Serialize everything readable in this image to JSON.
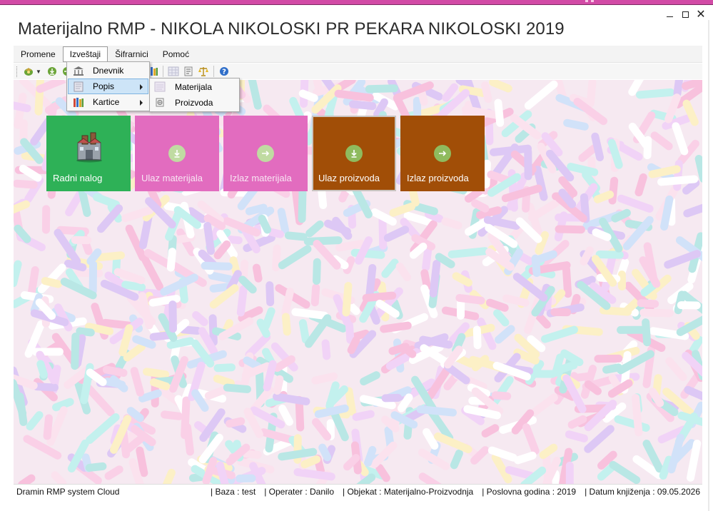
{
  "window": {
    "title": "Materijalno RMP - NIKOLA NIKOLOSKI PR PEKARA NIKOLOSKI 2019",
    "controls": {
      "minimize": "minimize-icon",
      "maximize": "maximize-icon",
      "close": "close-icon"
    }
  },
  "menu": {
    "items": [
      {
        "label": "Promene"
      },
      {
        "label": "Izveštaji",
        "active": true
      },
      {
        "label": "Šifrarnici"
      },
      {
        "label": "Pomoć"
      }
    ]
  },
  "reports_menu": {
    "items": [
      {
        "label": "Dnevnik",
        "icon": "bank-building-icon"
      },
      {
        "label": "Popis",
        "icon": "inventory-list-icon",
        "submenu": true,
        "hovered": true
      },
      {
        "label": "Kartice",
        "icon": "cards-icon",
        "submenu": true
      }
    ]
  },
  "popis_submenu": {
    "items": [
      {
        "label": "Materijala",
        "icon": "materials-icon"
      },
      {
        "label": "Proizvoda",
        "icon": "products-icon"
      }
    ]
  },
  "toolbar": {
    "icons": [
      "refresh-icon",
      "download-green-icon",
      "arrow-green-icon",
      "books-icon",
      "grid-icon",
      "document-icon",
      "scales-icon",
      "help-icon"
    ]
  },
  "tiles": [
    {
      "label": "Radni nalog",
      "color": "#2eb157",
      "icon": "factory-icon"
    },
    {
      "label": "Ulaz materijala",
      "color": "#e26cbf",
      "icon": "download-icon"
    },
    {
      "label": "Izlaz materijala",
      "color": "#e26cbf",
      "icon": "arrow-right-icon"
    },
    {
      "label": "Ulaz proizvoda",
      "color": "#a14e07",
      "icon": "download-icon"
    },
    {
      "label": "Izlaz proizvoda",
      "color": "#a14e07",
      "icon": "arrow-right-icon"
    }
  ],
  "status": {
    "left": "Dramin RMP system Cloud",
    "baza": "| Baza : test",
    "operater": "| Operater : Danilo",
    "objekat": "| Objekat : Materijalno-Proizvodnja",
    "godina": "| Poslovna godina : 2019",
    "datum": "| Datum knjiženja : 09.05.2026"
  }
}
